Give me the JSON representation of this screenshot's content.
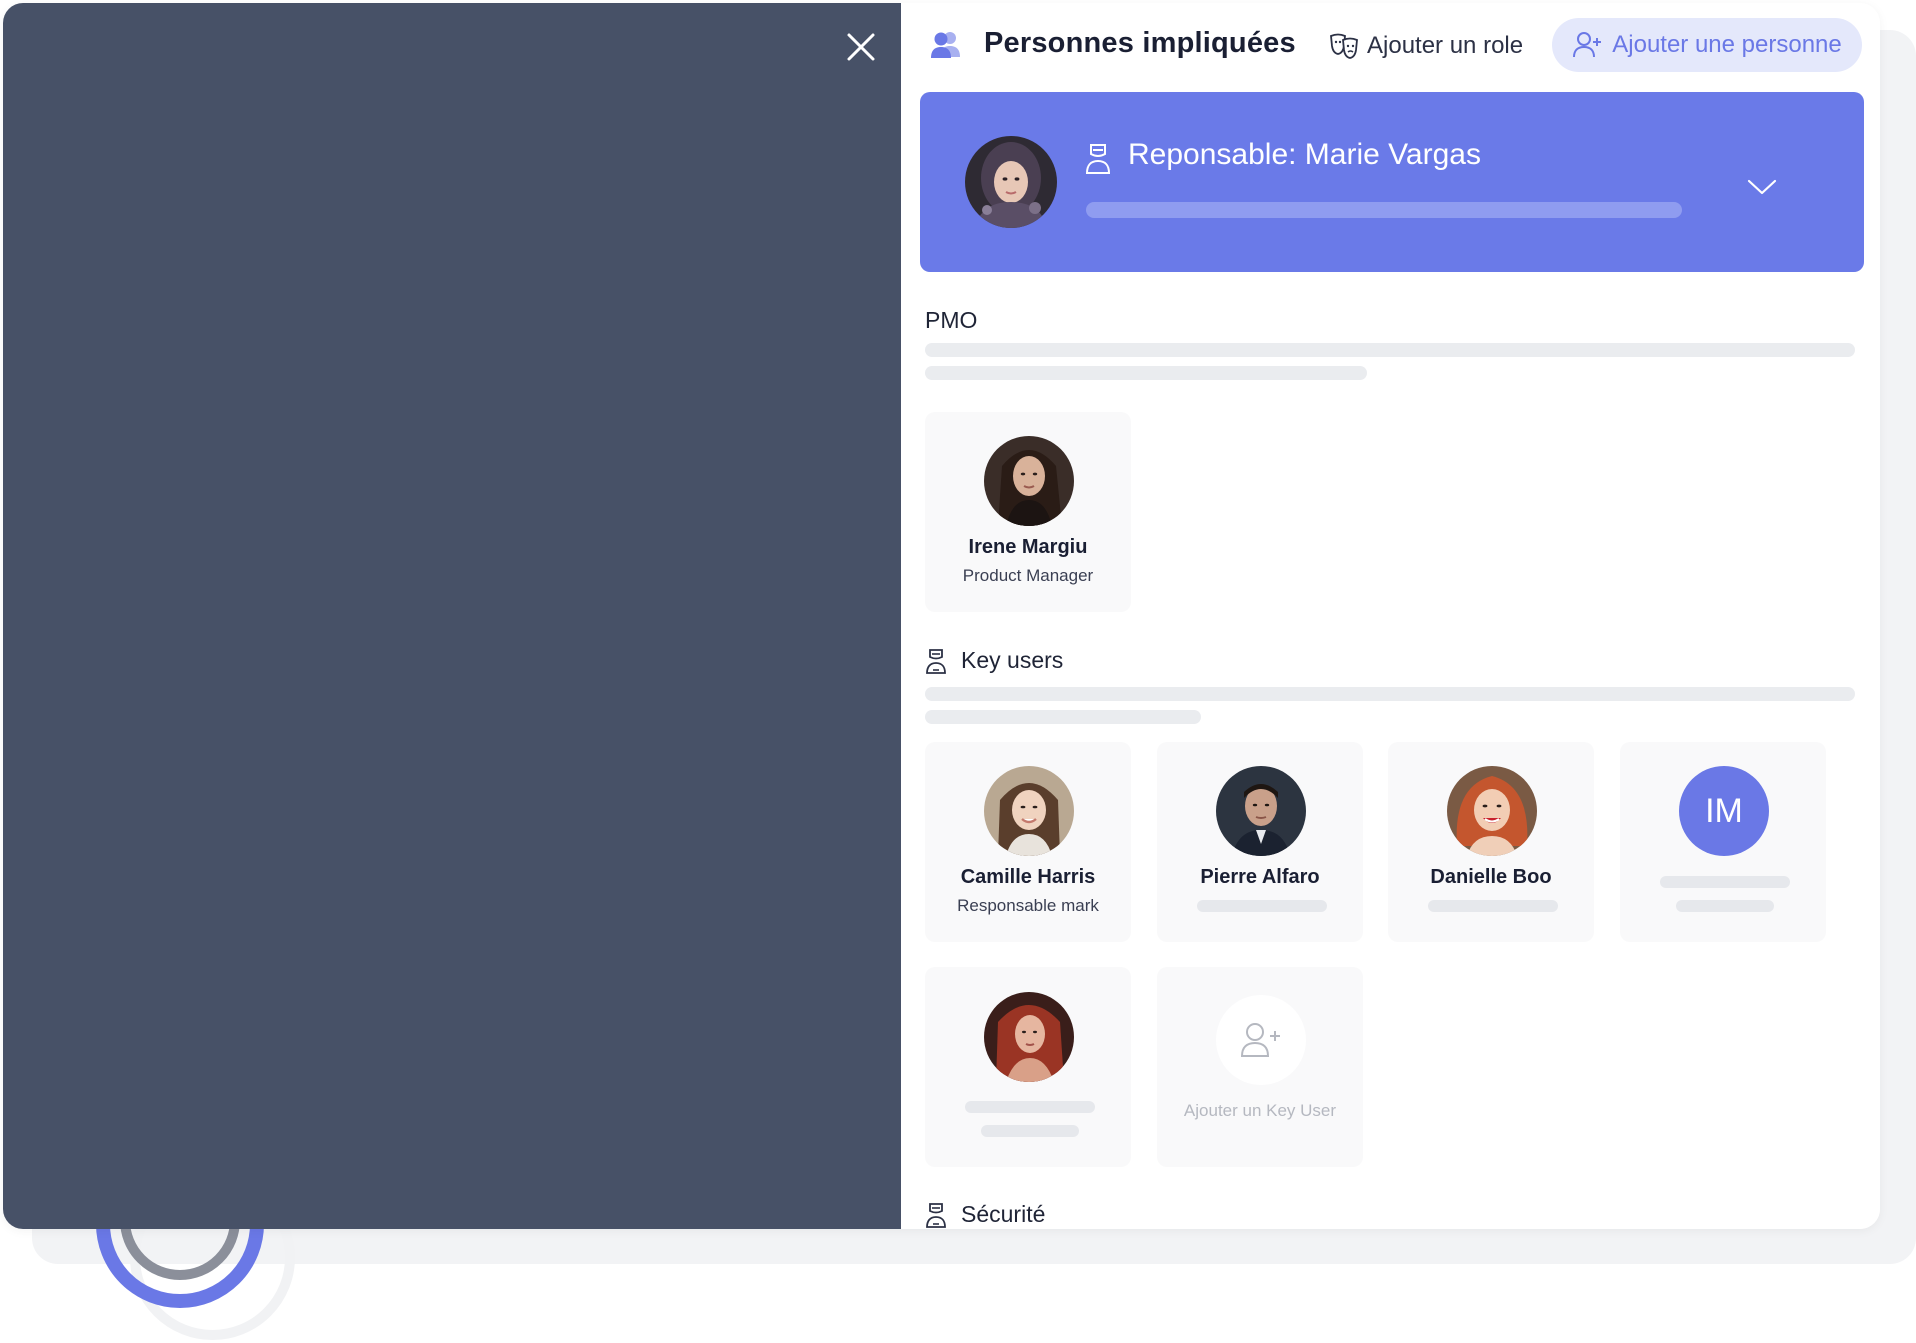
{
  "header": {
    "title": "Personnes impliquées",
    "add_role_label": "Ajouter un role",
    "add_person_label": "Ajouter une personne"
  },
  "responsable": {
    "title": "Reponsable: Marie Vargas"
  },
  "sections": {
    "pmo": {
      "title": "PMO"
    },
    "key_users": {
      "title": "Key users"
    },
    "securite": {
      "title": "Sécurité"
    }
  },
  "pmo_people": [
    {
      "name": "Irene Margiu",
      "role": "Product Manager"
    }
  ],
  "key_users": [
    {
      "name": "Camille Harris",
      "role": "Responsable mark"
    },
    {
      "name": "Pierre Alfaro"
    },
    {
      "name": "Danielle Boo"
    },
    {
      "initials": "IM"
    }
  ],
  "add_key_user_label": "Ajouter un Key User",
  "colors": {
    "accent": "#6a78e6",
    "overlay": "#475167",
    "card_blue": "#6a7ae8"
  },
  "icons": {
    "close": "close-icon",
    "people": "people-icon",
    "role": "theater-masks-icon",
    "add_person": "add-person-icon",
    "chevron": "chevron-down-icon",
    "user_role": "user-role-icon"
  }
}
